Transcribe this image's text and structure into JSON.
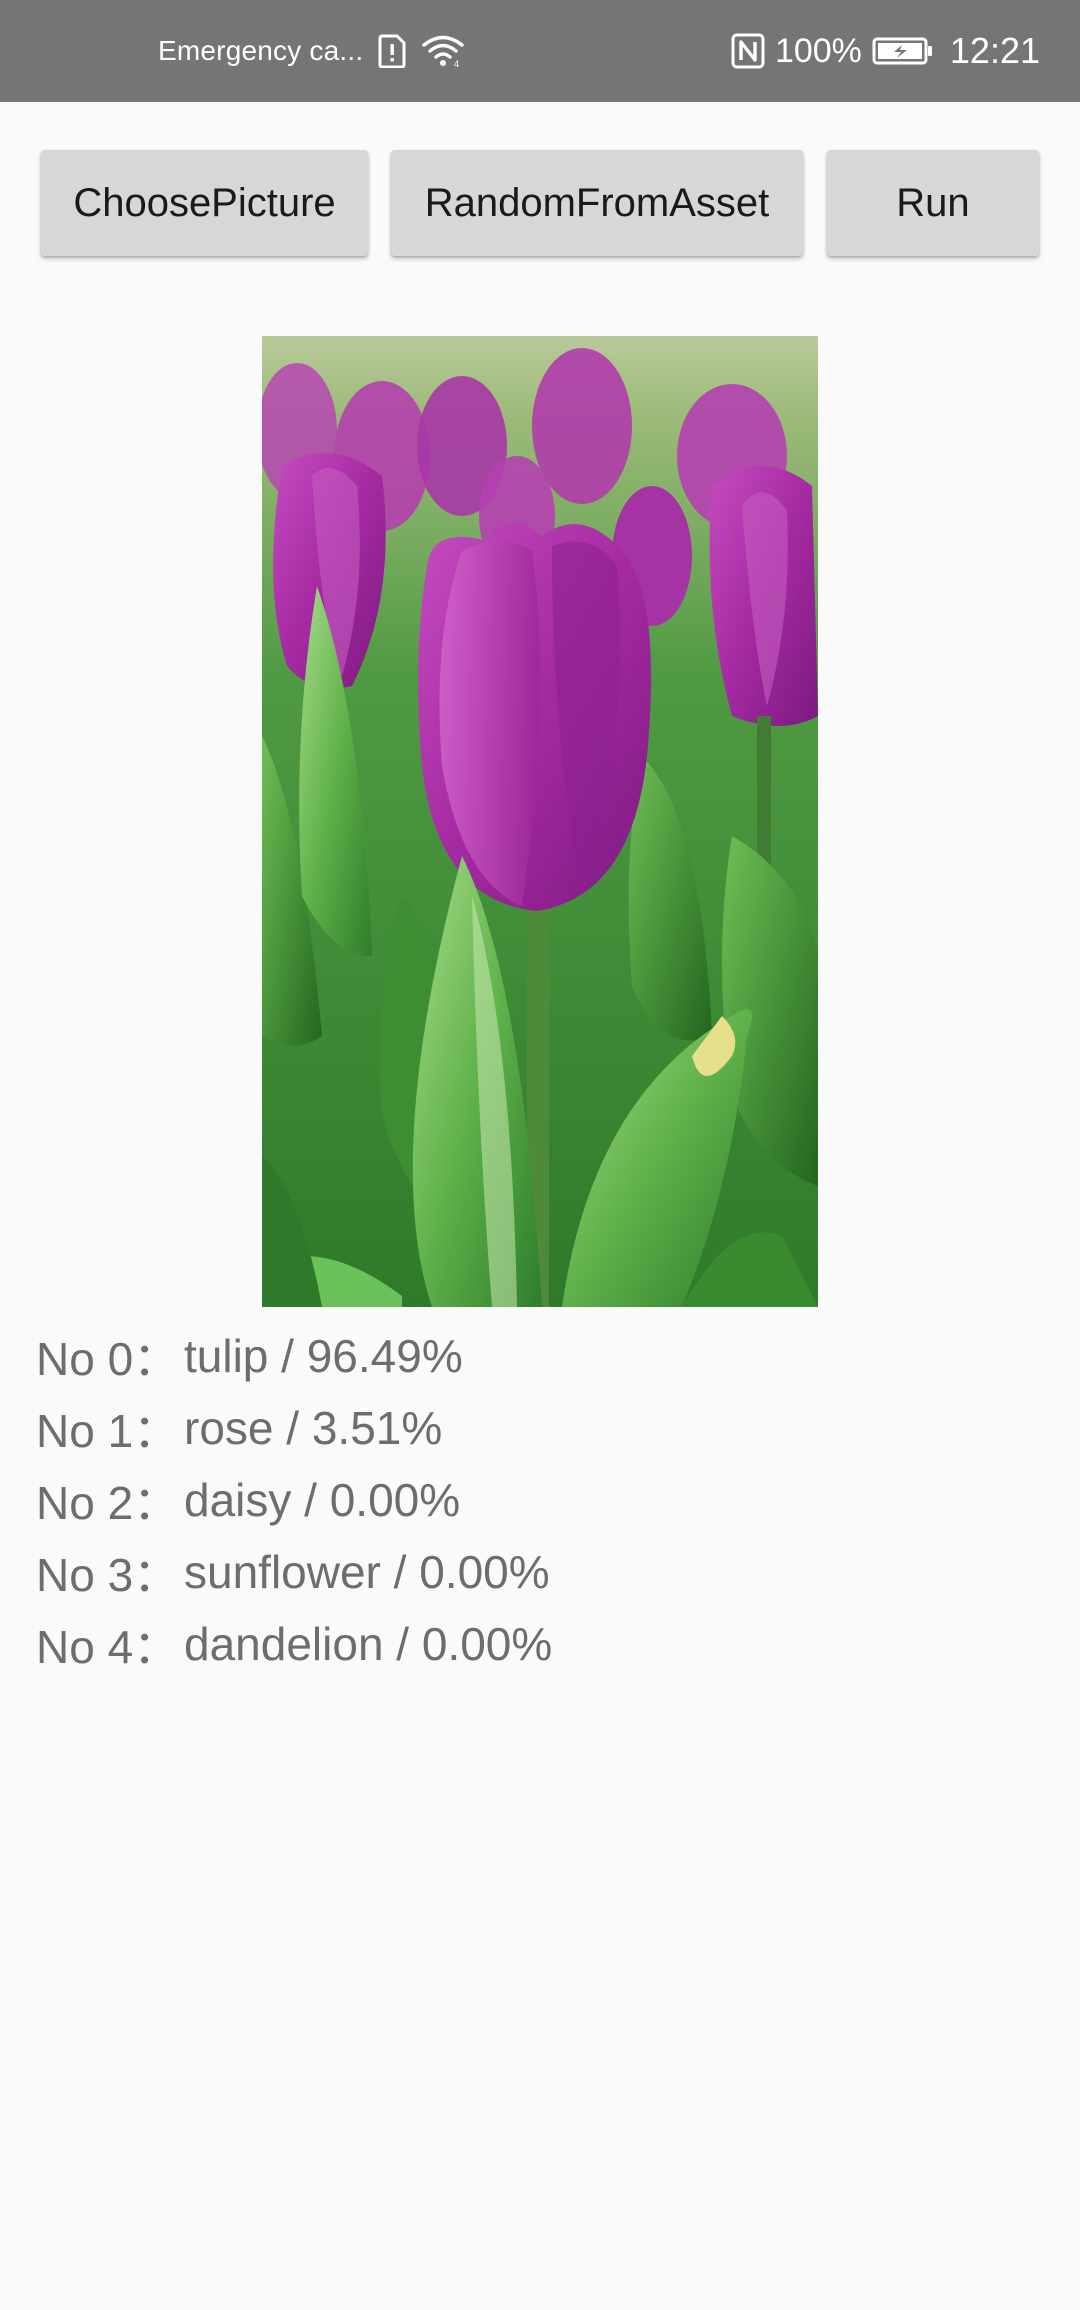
{
  "status_bar": {
    "carrier": "Emergency ca...",
    "battery_percent": "100%",
    "time": "12:21",
    "icons": [
      "sim-alert-icon",
      "wifi-icon",
      "nfc-icon",
      "battery-charging-icon"
    ]
  },
  "toolbar": {
    "choose_label": "ChoosePicture",
    "random_label": "RandomFromAsset",
    "run_label": "Run"
  },
  "image": {
    "subject": "purple tulips photo"
  },
  "results": [
    {
      "no": "No 0：",
      "label": "tulip / 96.49%"
    },
    {
      "no": "No 1：",
      "label": "rose / 3.51%"
    },
    {
      "no": "No 2：",
      "label": "daisy / 0.00%"
    },
    {
      "no": "No 3：",
      "label": "sunflower / 0.00%"
    },
    {
      "no": "No 4：",
      "label": "dandelion / 0.00%"
    }
  ],
  "colors": {
    "status_bar_bg": "#757575",
    "page_bg": "#fafafa",
    "button_bg": "#d6d7d7",
    "result_text": "#6d6d6d"
  }
}
